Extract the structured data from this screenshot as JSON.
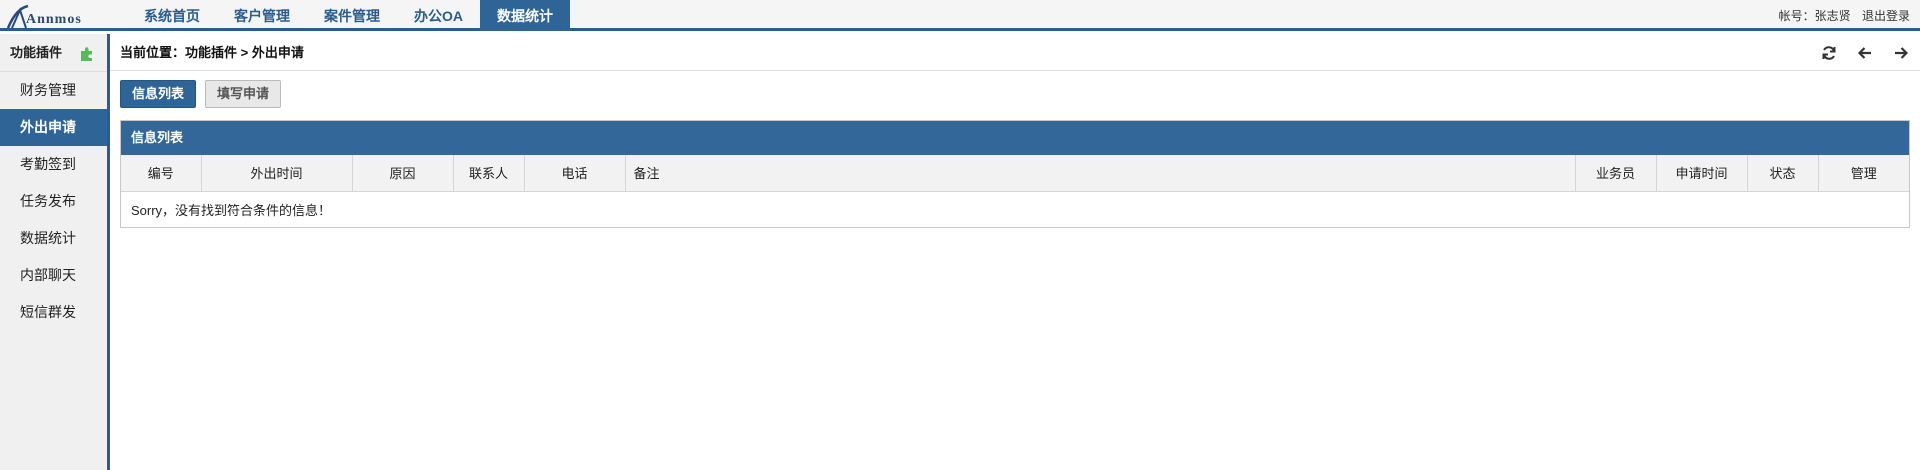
{
  "brand": {
    "logo_text": "Annmos"
  },
  "nav": {
    "items": [
      {
        "label": "系统首页"
      },
      {
        "label": "客户管理"
      },
      {
        "label": "案件管理"
      },
      {
        "label": "办公OA"
      },
      {
        "label": "数据统计"
      }
    ],
    "active_index": 4
  },
  "user": {
    "account_label": "帐号：张志贤",
    "logout_label": "退出登录"
  },
  "sidebar": {
    "title": "功能插件",
    "items": [
      {
        "label": "财务管理"
      },
      {
        "label": "外出申请"
      },
      {
        "label": "考勤签到"
      },
      {
        "label": "任务发布"
      },
      {
        "label": "数据统计"
      },
      {
        "label": "内部聊天"
      },
      {
        "label": "短信群发"
      }
    ],
    "active_index": 1
  },
  "breadcrumb": {
    "text": "当前位置：功能插件 > 外出申请"
  },
  "toolbar_icons": [
    "refresh-icon",
    "back-arrow-icon",
    "forward-arrow-icon"
  ],
  "actions": {
    "list_label": "信息列表",
    "fill_label": "填写申请"
  },
  "panel": {
    "title": "信息列表",
    "columns": [
      "编号",
      "外出时间",
      "原因",
      "联系人",
      "电话",
      "备注",
      "业务员",
      "申请时间",
      "状态",
      "管理"
    ],
    "empty_message": "Sorry，没有找到符合条件的信息！"
  },
  "colors": {
    "primary": "#2f6496",
    "panel_header": "#336699",
    "puzzle_green": "#5cb85c"
  }
}
